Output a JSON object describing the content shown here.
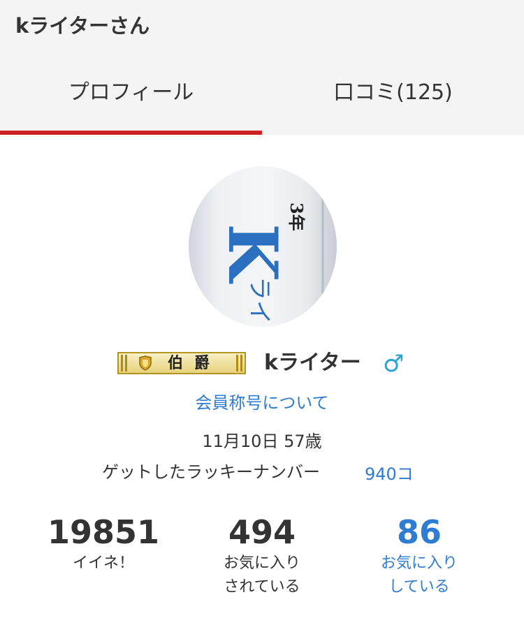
{
  "header": {
    "title": "kライターさん"
  },
  "tabs": [
    {
      "label": "プロフィール",
      "active": true
    },
    {
      "label": "口コミ(125)",
      "active": false
    }
  ],
  "profile": {
    "avatar_text": {
      "top": "3年",
      "big_letter": "K",
      "bottom": "ライ"
    },
    "rank_badge": "伯爵",
    "user_name": "kライター",
    "gender_icon": "male-symbol",
    "member_title_link": "会員称号について",
    "birthday_age": "11月10日 57歳",
    "lucky_number_label": "ゲットしたラッキーナンバー",
    "lucky_number_value": "940コ"
  },
  "stats": [
    {
      "value": "19851",
      "label": "イイネ！"
    },
    {
      "value": "494",
      "label": "お気に入り\nされている"
    },
    {
      "value": "86",
      "label": "お気に入り\nしている"
    }
  ],
  "colors": {
    "accent_red": "#cc2222",
    "link_blue": "#2f7cd3",
    "gender_blue": "#2aa3d8",
    "header_bg": "#f4f4f4"
  }
}
